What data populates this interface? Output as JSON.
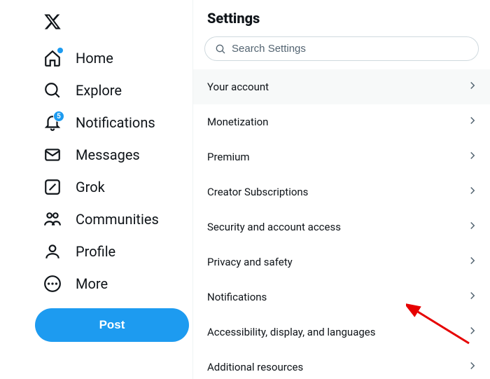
{
  "sidebar": {
    "items": [
      {
        "label": "Home",
        "icon": "home-icon",
        "dot": true
      },
      {
        "label": "Explore",
        "icon": "search-icon"
      },
      {
        "label": "Notifications",
        "icon": "bell-icon",
        "badge": "5"
      },
      {
        "label": "Messages",
        "icon": "mail-icon"
      },
      {
        "label": "Grok",
        "icon": "grok-icon"
      },
      {
        "label": "Communities",
        "icon": "communities-icon"
      },
      {
        "label": "Profile",
        "icon": "profile-icon"
      },
      {
        "label": "More",
        "icon": "more-icon"
      }
    ],
    "post_label": "Post"
  },
  "header": {
    "title": "Settings"
  },
  "search": {
    "placeholder": "Search Settings"
  },
  "settings": {
    "items": [
      {
        "label": "Your account",
        "active": true
      },
      {
        "label": "Monetization"
      },
      {
        "label": "Premium"
      },
      {
        "label": "Creator Subscriptions"
      },
      {
        "label": "Security and account access"
      },
      {
        "label": "Privacy and safety"
      },
      {
        "label": "Notifications"
      },
      {
        "label": "Accessibility, display, and languages"
      },
      {
        "label": "Additional resources"
      }
    ]
  }
}
